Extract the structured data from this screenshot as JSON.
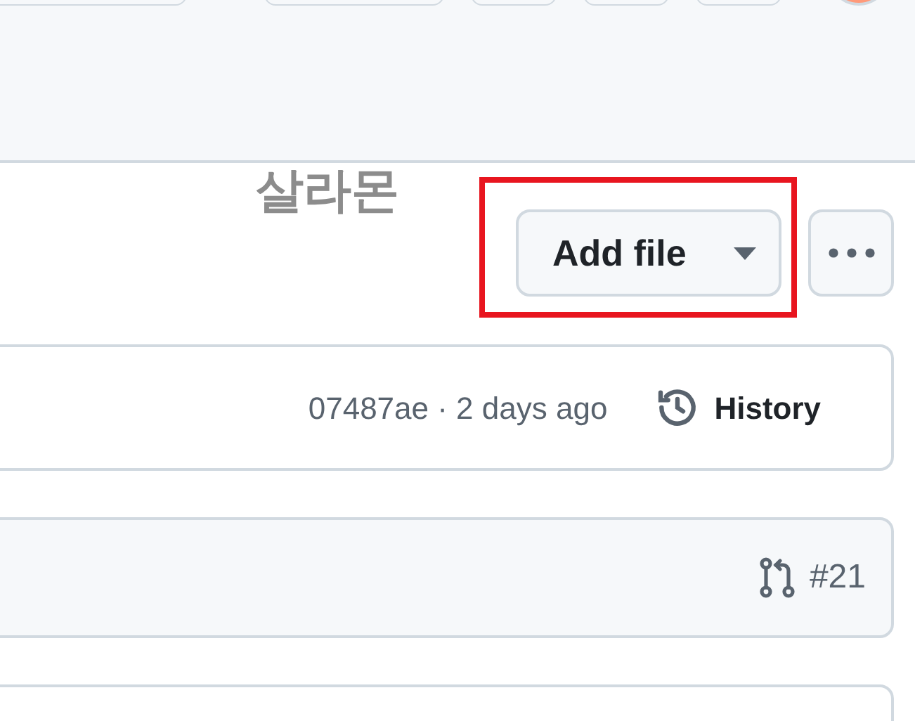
{
  "title": "살라몬",
  "add_file_button": {
    "label": "Add file",
    "highlighted": true
  },
  "commit_bar": {
    "info": "07487ae · 2 days ago",
    "history": "History"
  },
  "pull_request": {
    "number": "#21"
  }
}
